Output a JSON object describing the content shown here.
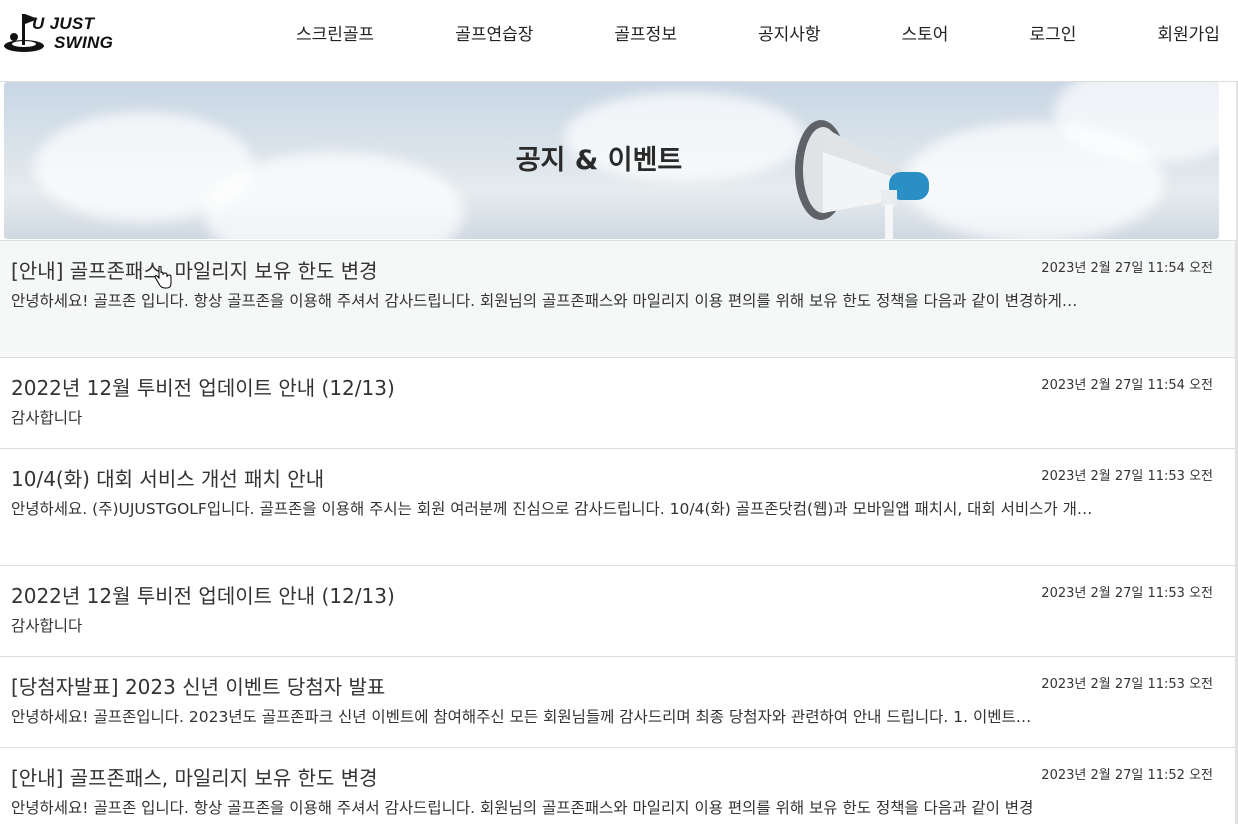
{
  "header": {
    "logo_line1": "U JUST",
    "logo_line2": "SWING",
    "nav": [
      "스크린골프",
      "골프연습장",
      "골프정보",
      "공지사항",
      "스토어",
      "로그인",
      "회원가입"
    ]
  },
  "banner": {
    "title": "공지 & 이벤트",
    "icon": "megaphone-icon"
  },
  "notices": [
    {
      "title": "[안내] 골프존패스, 마일리지 보유 한도 변경",
      "date": "2023년 2월 27일 11:54 오전",
      "desc": "안녕하세요! 골프존 입니다. 항상 골프존을 이용해 주셔서 감사드립니다. 회원님의 골프존패스와 마일리지 이용 편의를 위해 보유 한도 정책을 다음과 같이 변경하게…"
    },
    {
      "title": "2022년 12월 투비전 업데이트 안내 (12/13)",
      "date": "2023년 2월 27일 11:54 오전",
      "desc": "감사합니다"
    },
    {
      "title": "10/4(화) 대회 서비스 개선 패치 안내",
      "date": "2023년 2월 27일 11:53 오전",
      "desc": "안녕하세요. (주)UJUSTGOLF입니다. 골프존을 이용해 주시는 회원 여러분께 진심으로 감사드립니다. 10/4(화) 골프존닷컴(웹)과 모바일앱 패치시, 대회 서비스가 개…"
    },
    {
      "title": "2022년 12월 투비전 업데이트 안내 (12/13)",
      "date": "2023년 2월 27일 11:53 오전",
      "desc": "감사합니다"
    },
    {
      "title": "[당첨자발표] 2023 신년 이벤트 당첨자 발표",
      "date": "2023년 2월 27일 11:53 오전",
      "desc": "안녕하세요! 골프존입니다. 2023년도 골프존파크 신년 이벤트에 참여해주신 모든 회원님들께 감사드리며 최종 당첨자와 관련하여 안내 드립니다. 1. 이벤트…"
    },
    {
      "title": "[안내] 골프존패스, 마일리지 보유 한도 변경",
      "date": "2023년 2월 27일 11:52 오전",
      "desc": "안녕하세요! 골프존 입니다. 항상 골프존을 이용해 주셔서 감사드립니다. 회원님의 골프존패스와 마일리지 이용 편의를 위해 보유 한도 정책을 다음과 같이 변경"
    }
  ]
}
